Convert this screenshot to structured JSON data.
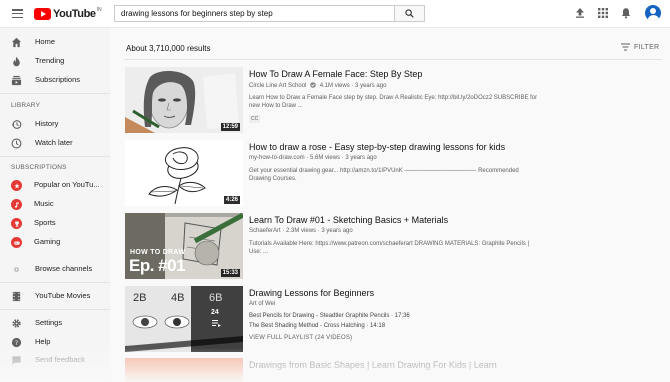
{
  "header": {
    "logo_text": "YouTube",
    "logo_country": "IN",
    "search_value": "drawing lessons for beginners step by step"
  },
  "sidebar": {
    "main": [
      {
        "label": "Home",
        "icon": "home-icon"
      },
      {
        "label": "Trending",
        "icon": "flame-icon"
      },
      {
        "label": "Subscriptions",
        "icon": "subscriptions-icon"
      }
    ],
    "library_heading": "LIBRARY",
    "library": [
      {
        "label": "History",
        "icon": "history-icon"
      },
      {
        "label": "Watch later",
        "icon": "clock-icon"
      }
    ],
    "subscriptions_heading": "SUBSCRIPTIONS",
    "subscriptions": [
      {
        "label": "Popular on YouTu...",
        "icon": "star-icon",
        "color": "#e53935"
      },
      {
        "label": "Music",
        "icon": "music-note-icon",
        "color": "#e53935"
      },
      {
        "label": "Sports",
        "icon": "trophy-icon",
        "color": "#e53935"
      },
      {
        "label": "Gaming",
        "icon": "gamepad-icon",
        "color": "#e53935"
      }
    ],
    "browse_channels": "Browse channels",
    "youtube_movies": "YouTube Movies",
    "settings": "Settings",
    "help": "Help",
    "send_feedback": "Send feedback"
  },
  "results": {
    "count": "About 3,710,000 results",
    "filter_label": "FILTER",
    "videos": [
      {
        "title": "How To Draw A Female Face: Step By Step",
        "channel": "Circle Line Art School",
        "verified": true,
        "stats": "4.1M views · 3 years ago",
        "desc": "Learn How to Draw a Female Face step by step. Draw A Realistic Eye: http://bit.ly/2oDOcz2 SUBSCRIBE for new How to Draw ...",
        "badge": "CC",
        "duration": "12:59"
      },
      {
        "title": "How to draw a rose - Easy step-by-step drawing lessons for kids",
        "channel": "my-how-to-draw.com",
        "stats": "5.6M views · 3 years ago",
        "desc": "Get your essential drawing gear... http://amzn.to/1IPVUnK ———————————— Recommended Drawing Courses.",
        "duration": "4:26"
      },
      {
        "title": "Learn To Draw #01 - Sketching Basics + Materials",
        "channel": "SchaeferArt",
        "stats": "2.3M views · 3 years ago",
        "desc": "Tutorials Available Here: https://www.patreon.com/schaeferart DRAWING MATERIALS: Graphite Pencils | Use: ...",
        "duration": "15:33",
        "thumb_text_1": "HOW TO DRAW",
        "thumb_text_2": "Ep. #01"
      },
      {
        "title": "Drawing Lessons for Beginners",
        "channel": "Art of Wei",
        "playlist_items": [
          "Best Pencils for Drawing - Steadtler Graphite Pencils · 17:36",
          "The Best Shading Method - Cross Hatching · 14:18"
        ],
        "playlist_count": "24",
        "view_full": "VIEW FULL PLAYLIST (24 VIDEOS)",
        "thumb_labels": [
          "2B",
          "4B",
          "6B"
        ]
      },
      {
        "title": "Drawings from Basic Shapes | Learn Drawing For Kids | Learn"
      }
    ]
  },
  "colors": {
    "brand_red": "#ff0000",
    "avatar": "#1565c0"
  }
}
